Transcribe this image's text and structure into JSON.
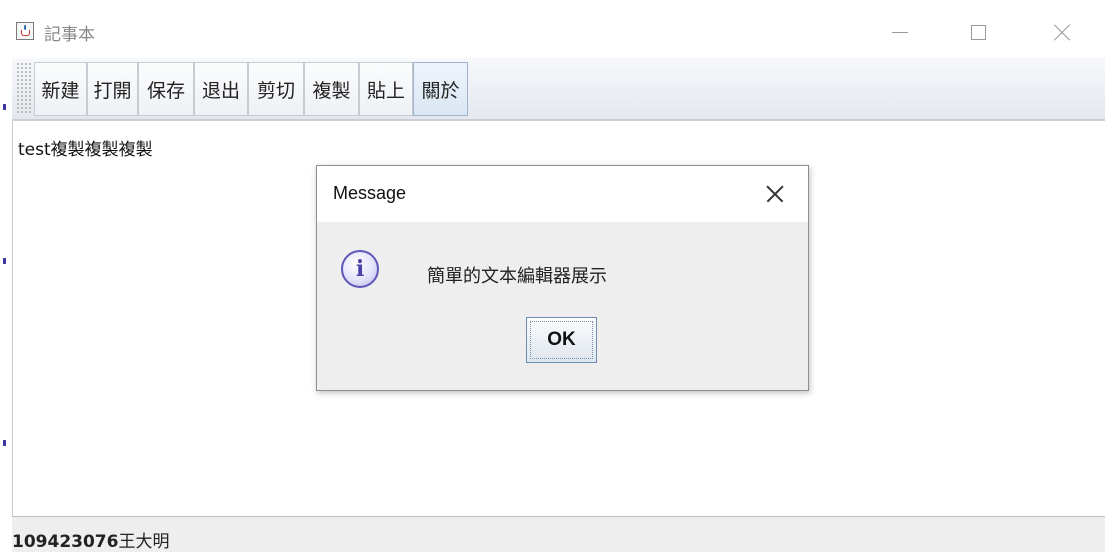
{
  "window": {
    "title": "記事本"
  },
  "toolbar": {
    "buttons": [
      {
        "label": "新建"
      },
      {
        "label": "打開"
      },
      {
        "label": "保存"
      },
      {
        "label": "退出"
      },
      {
        "label": "剪切"
      },
      {
        "label": "複製"
      },
      {
        "label": "貼上"
      },
      {
        "label": "關於"
      }
    ]
  },
  "editor": {
    "text": "test複製複製複製"
  },
  "status": {
    "id": "109423076",
    "name": "王大明"
  },
  "dialog": {
    "title": "Message",
    "message": "簡單的文本編輯器展示",
    "ok_label": "OK",
    "icon": "info-icon"
  }
}
